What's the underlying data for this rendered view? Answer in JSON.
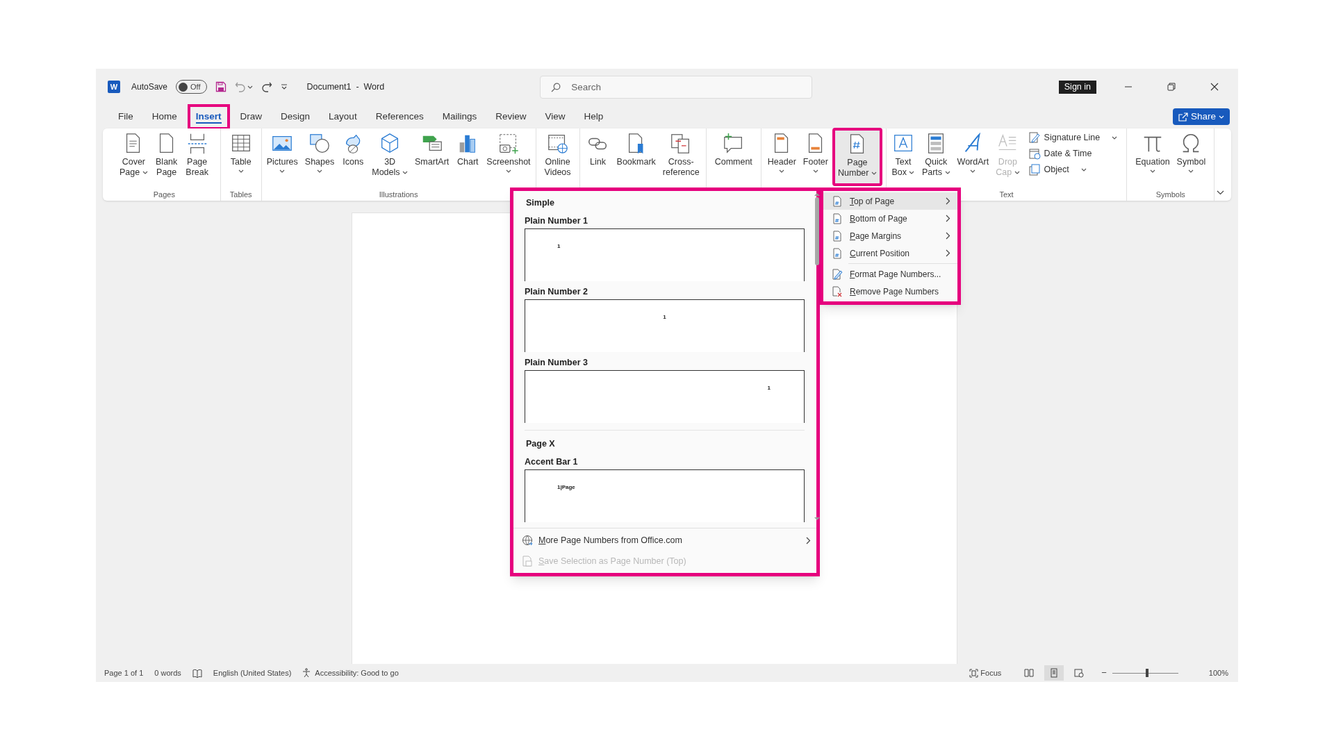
{
  "title_bar": {
    "app_logo": "W",
    "autosave_label": "AutoSave",
    "autosave": {
      "on": false,
      "label": "Off"
    },
    "document_title": "Document1  -  Word",
    "search": {
      "placeholder": "Search"
    },
    "sign_in": "Sign in"
  },
  "tabs": [
    {
      "label": "File",
      "selected": false,
      "highlighted": false
    },
    {
      "label": "Home",
      "selected": false,
      "highlighted": false
    },
    {
      "label": "Insert",
      "selected": true,
      "highlighted": true
    },
    {
      "label": "Draw",
      "selected": false,
      "highlighted": false
    },
    {
      "label": "Design",
      "selected": false,
      "highlighted": false
    },
    {
      "label": "Layout",
      "selected": false,
      "highlighted": false
    },
    {
      "label": "References",
      "selected": false,
      "highlighted": false
    },
    {
      "label": "Mailings",
      "selected": false,
      "highlighted": false
    },
    {
      "label": "Review",
      "selected": false,
      "highlighted": false
    },
    {
      "label": "View",
      "selected": false,
      "highlighted": false
    },
    {
      "label": "Help",
      "selected": false,
      "highlighted": false
    }
  ],
  "share": "Share",
  "ribbon_groups": [
    {
      "label": "Pages",
      "buttons": [
        {
          "kind": "cover",
          "lines": [
            "Cover",
            "Page"
          ],
          "dropdown": true
        },
        {
          "kind": "blank",
          "lines": [
            "Blank",
            "Page"
          ],
          "dropdown": false
        },
        {
          "kind": "break",
          "lines": [
            "Page",
            "Break"
          ],
          "dropdown": false
        }
      ]
    },
    {
      "label": "Tables",
      "buttons": [
        {
          "kind": "table",
          "lines": [
            "Table"
          ],
          "dropdown": true
        }
      ]
    },
    {
      "label": "Illustrations",
      "buttons": [
        {
          "kind": "pictures",
          "lines": [
            "Pictures"
          ],
          "dropdown": true
        },
        {
          "kind": "shapes",
          "lines": [
            "Shapes"
          ],
          "dropdown": true
        },
        {
          "kind": "icons",
          "lines": [
            "Icons"
          ],
          "dropdown": false
        },
        {
          "kind": "cube",
          "lines": [
            "3D",
            "Models"
          ],
          "dropdown": true
        },
        {
          "kind": "smartart",
          "lines": [
            "SmartArt"
          ],
          "dropdown": false
        },
        {
          "kind": "chart",
          "lines": [
            "Chart"
          ],
          "dropdown": false
        },
        {
          "kind": "screenshot",
          "lines": [
            "Screenshot"
          ],
          "dropdown": true
        }
      ]
    },
    {
      "buttons": [
        {
          "kind": "video",
          "lines": [
            "Online",
            "Videos"
          ],
          "dropdown": false
        }
      ]
    },
    {
      "buttons": [
        {
          "kind": "link",
          "lines": [
            "Link"
          ],
          "dropdown": false
        },
        {
          "kind": "bookmark",
          "lines": [
            "Bookmark"
          ],
          "dropdown": false
        },
        {
          "kind": "crossref",
          "lines": [
            "Cross-",
            "reference"
          ],
          "dropdown": false
        }
      ]
    },
    {
      "buttons": [
        {
          "kind": "comment",
          "lines": [
            "Comment"
          ],
          "dropdown": false
        }
      ]
    },
    {
      "buttons": [
        {
          "kind": "header",
          "lines": [
            "Header"
          ],
          "dropdown": true
        },
        {
          "kind": "footer",
          "lines": [
            "Footer"
          ],
          "dropdown": true
        },
        {
          "kind": "pagenumber",
          "lines": [
            "Page",
            "Number"
          ],
          "dropdown": true,
          "highlighted": true
        }
      ]
    },
    {
      "label": "Text",
      "buttons": [
        {
          "kind": "textbox",
          "lines": [
            "Text",
            "Box"
          ],
          "dropdown": true
        },
        {
          "kind": "quickparts",
          "lines": [
            "Quick",
            "Parts"
          ],
          "dropdown": true
        },
        {
          "kind": "wordart",
          "lines": [
            "WordArt"
          ],
          "dropdown": true
        },
        {
          "kind": "dropcap",
          "lines": [
            "Drop",
            "Cap"
          ],
          "dropdown": true,
          "disabled": true
        }
      ],
      "small_buttons": [
        {
          "kind": "signature",
          "label": "Signature Line",
          "dropdown": true
        },
        {
          "kind": "datetime",
          "label": "Date & Time",
          "dropdown": false
        },
        {
          "kind": "object",
          "label": "Object",
          "dropdown": true
        }
      ]
    },
    {
      "label": "Symbols",
      "buttons": [
        {
          "kind": "equation",
          "lines": [
            "Equation"
          ],
          "dropdown": true
        },
        {
          "kind": "symbol",
          "lines": [
            "Symbol"
          ],
          "dropdown": true
        }
      ]
    }
  ],
  "page_number_gallery": {
    "highlighted": true,
    "sections": [
      {
        "heading": "Simple",
        "items": [
          {
            "label": "Plain Number 1",
            "preview": "1",
            "kind": "left"
          },
          {
            "label": "Plain Number 2",
            "preview": "1",
            "kind": "center"
          },
          {
            "label": "Plain Number 3",
            "preview": "1",
            "kind": "right"
          }
        ]
      },
      {
        "heading": "Page X",
        "items": [
          {
            "label": "Accent Bar 1",
            "preview": "1|Page",
            "kind": "left"
          }
        ]
      }
    ],
    "footer_items": [
      {
        "kind": "globe",
        "label": "More Page Numbers from Office.com",
        "submenu": true,
        "disabled": false
      },
      {
        "kind": "save",
        "label": "Save Selection as Page Number (Top)",
        "submenu": false,
        "disabled": true
      }
    ]
  },
  "page_number_menu": {
    "highlighted": true,
    "items": [
      {
        "kind": "top",
        "label": "Top of Page",
        "submenu": true,
        "selected": true
      },
      {
        "kind": "bottom",
        "label": "Bottom of Page",
        "submenu": true,
        "selected": false
      },
      {
        "kind": "margins",
        "label": "Page Margins",
        "submenu": true,
        "selected": false
      },
      {
        "kind": "current",
        "label": "Current Position",
        "submenu": true,
        "selected": false
      },
      {
        "kind": "format",
        "label": "Format Page Numbers...",
        "submenu": false,
        "selected": false
      },
      {
        "kind": "remove",
        "label": "Remove Page Numbers",
        "submenu": false,
        "selected": false
      }
    ]
  },
  "status_bar": {
    "left": [
      {
        "kind": "text",
        "label": "Page 1 of 1"
      },
      {
        "kind": "text",
        "label": "0 words"
      },
      {
        "kind": "proofing"
      },
      {
        "kind": "text",
        "label": "English (United States)"
      },
      {
        "kind": "accessibility",
        "label": "Accessibility: Good to go"
      }
    ],
    "focus": "Focus",
    "views": [
      {
        "kind": "read",
        "selected": false
      },
      {
        "kind": "print",
        "selected": true
      },
      {
        "kind": "web",
        "selected": false
      }
    ],
    "zoom": {
      "out": "−",
      "level": 0.53,
      "label": "100%"
    }
  }
}
